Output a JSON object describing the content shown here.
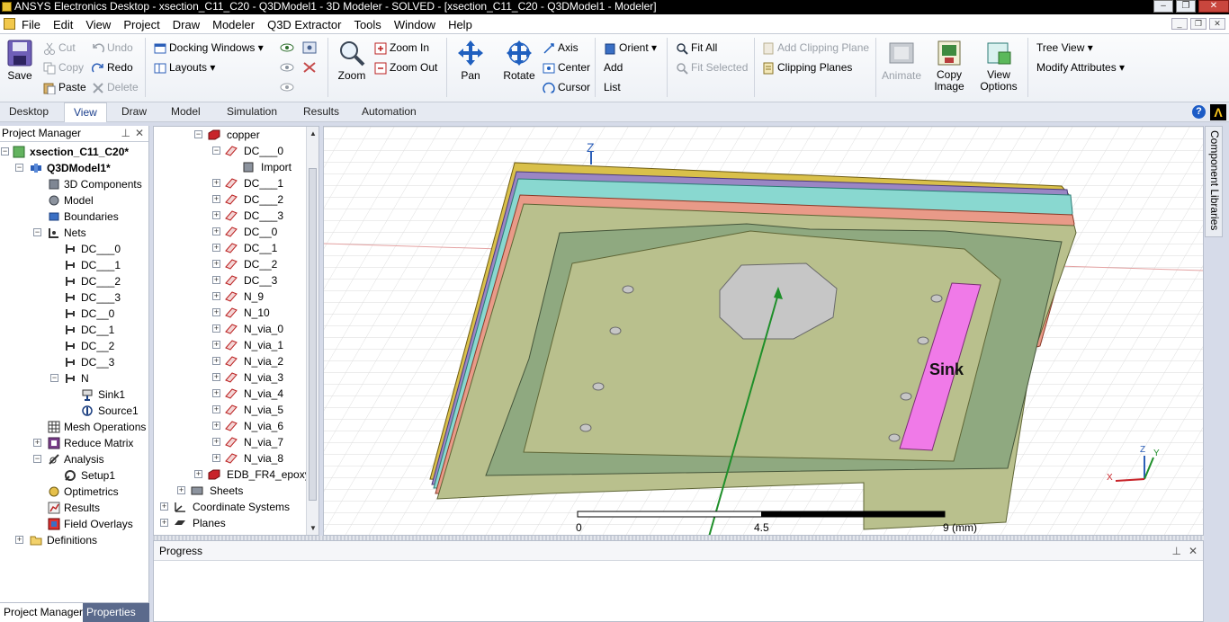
{
  "window": {
    "title": "ANSYS Electronics Desktop - xsection_C11_C20 - Q3DModel1 - 3D Modeler - SOLVED - [xsection_C11_C20 - Q3DModel1 - Modeler]",
    "buttons": [
      "minimize",
      "restore",
      "close"
    ]
  },
  "menu": {
    "items": [
      "File",
      "Edit",
      "View",
      "Project",
      "Draw",
      "Modeler",
      "Q3D Extractor",
      "Tools",
      "Window",
      "Help"
    ]
  },
  "ribbon": {
    "save": "Save",
    "cut": "Cut",
    "copy": "Copy",
    "paste": "Paste",
    "undo": "Undo",
    "redo": "Redo",
    "delete": "Delete",
    "docking_windows": "Docking Windows",
    "layouts": "Layouts",
    "zoom": "Zoom",
    "zoom_in": "Zoom In",
    "zoom_out": "Zoom Out",
    "pan": "Pan",
    "rotate": "Rotate",
    "axis": "Axis",
    "center": "Center",
    "cursor": "Cursor",
    "orient": "Orient",
    "add": "Add",
    "list": "List",
    "fit_all": "Fit All",
    "fit_selected": "Fit Selected",
    "add_clipping_plane": "Add Clipping Plane",
    "clipping_planes": "Clipping Planes",
    "animate": "Animate",
    "copy_image": "Copy Image",
    "view_options": "View Options",
    "tree_view": "Tree View",
    "modify_attributes": "Modify Attributes"
  },
  "tabs": [
    "Desktop",
    "View",
    "Draw",
    "Model",
    "Simulation",
    "Results",
    "Automation"
  ],
  "active_tab": "View",
  "project_manager": {
    "title": "Project Manager",
    "tree": [
      {
        "label": "xsection_C11_C20*",
        "bold": true
      },
      {
        "label": "Q3DModel1*",
        "bold": true
      },
      {
        "label": "3D Components"
      },
      {
        "label": "Model"
      },
      {
        "label": "Boundaries"
      },
      {
        "label": "Nets"
      },
      {
        "label": "DC___0"
      },
      {
        "label": "DC___1"
      },
      {
        "label": "DC___2"
      },
      {
        "label": "DC___3"
      },
      {
        "label": "DC__0"
      },
      {
        "label": "DC__1"
      },
      {
        "label": "DC__2"
      },
      {
        "label": "DC__3"
      },
      {
        "label": "N"
      },
      {
        "label": "Sink1"
      },
      {
        "label": "Source1"
      },
      {
        "label": "Mesh Operations"
      },
      {
        "label": "Reduce Matrix"
      },
      {
        "label": "Analysis"
      },
      {
        "label": "Setup1"
      },
      {
        "label": "Optimetrics"
      },
      {
        "label": "Results"
      },
      {
        "label": "Field Overlays"
      },
      {
        "label": "Definitions"
      }
    ],
    "bottom_tabs": [
      "Project Manager",
      "Properties"
    ]
  },
  "model_tree": {
    "items": [
      "copper",
      "DC___0",
      "Import",
      "DC___1",
      "DC___2",
      "DC___3",
      "DC__0",
      "DC__1",
      "DC__2",
      "DC__3",
      "N_9",
      "N_10",
      "N_via_0",
      "N_via_1",
      "N_via_2",
      "N_via_3",
      "N_via_4",
      "N_via_5",
      "N_via_6",
      "N_via_7",
      "N_via_8",
      "EDB_FR4_epoxy",
      "Sheets",
      "Coordinate Systems",
      "Planes"
    ]
  },
  "viewport": {
    "sink_label": "Sink",
    "axis_z": "Z",
    "scale_labels": [
      "0",
      "4.5",
      "9 (mm)"
    ],
    "triad": {
      "z": "Z",
      "y": "Y",
      "x": "X"
    }
  },
  "component_libraries": "Component Libraries",
  "progress": {
    "title": "Progress"
  },
  "colors": {
    "board": "#b9c08d",
    "copper": "#8fa980",
    "sink": "#f07ae8",
    "cyan_layer": "#89d8d0",
    "salmon_layer": "#e99a88",
    "yellow_layer": "#d9c04a"
  }
}
